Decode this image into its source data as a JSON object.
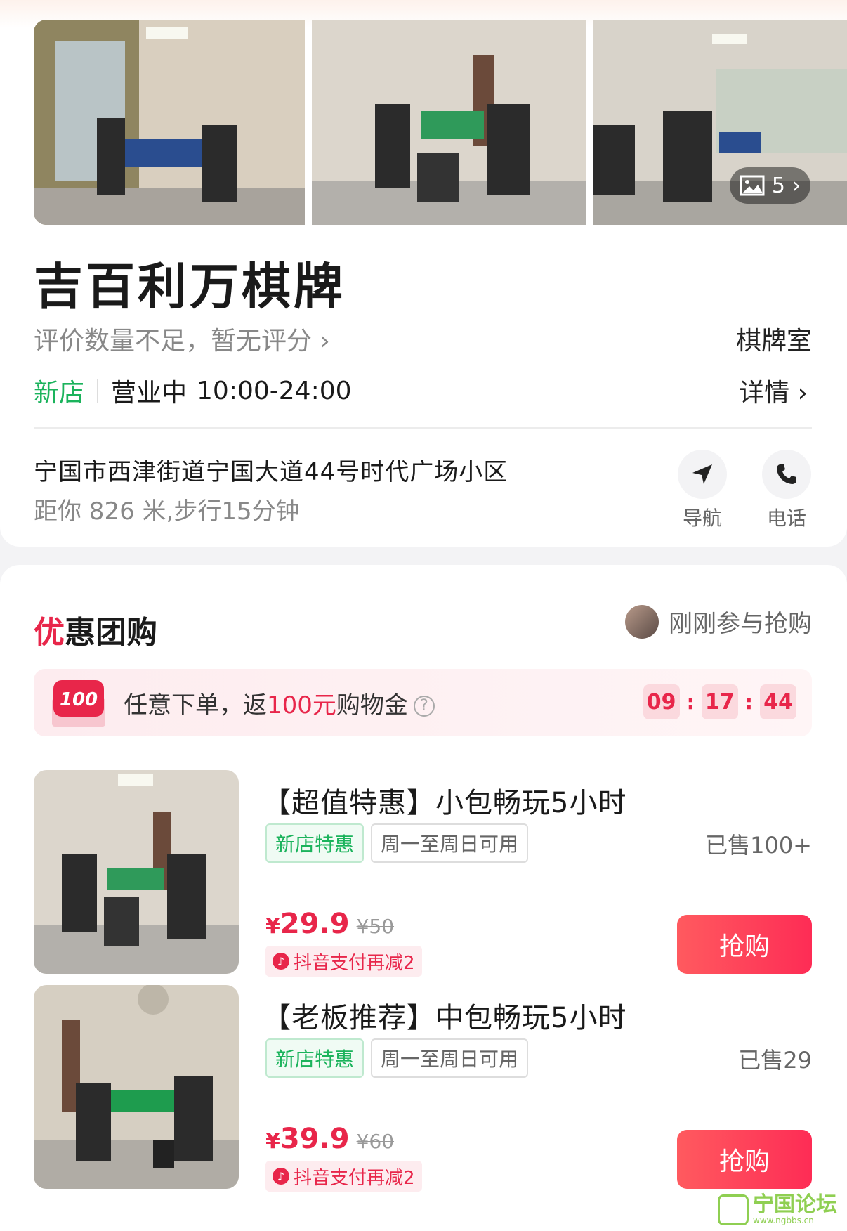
{
  "gallery": {
    "photo_count": "5"
  },
  "shop": {
    "name": "吉百利万棋牌",
    "rating_text": "评价数量不足，暂无评分",
    "category": "棋牌室",
    "new_label": "新店",
    "status": "营业中",
    "hours": "10:00-24:00",
    "detail_label": "详情",
    "address": "宁国市西津街道宁国大道44号时代广场小区",
    "distance": "距你 826 米,步行15分钟",
    "nav_label": "导航",
    "call_label": "电话"
  },
  "deals_section": {
    "title_first": "优",
    "title_rest": "惠团购",
    "recent_text": "刚刚参与抢购"
  },
  "promo": {
    "badge": "100",
    "text_before": "任意下单，返",
    "text_highlight": "100元",
    "text_after": "购物金",
    "help": "?",
    "countdown": {
      "h": "09",
      "m": "17",
      "s": "44",
      "sep": ":"
    }
  },
  "deals": [
    {
      "title": "【超值特惠】小包畅玩5小时",
      "tag1": "新店特惠",
      "tag2": "周一至周日可用",
      "sold": "已售100+",
      "yen": "¥",
      "price": "29.9",
      "orig": "¥50",
      "douyin": "抖音支付再减2",
      "buy": "抢购"
    },
    {
      "title": "【老板推荐】中包畅玩5小时",
      "tag1": "新店特惠",
      "tag2": "周一至周日可用",
      "sold": "已售29",
      "yen": "¥",
      "price": "39.9",
      "orig": "¥60",
      "douyin": "抖音支付再减2",
      "buy": "抢购"
    }
  ],
  "watermark": {
    "text": "宁国论坛",
    "url": "www.ngbbs.cn"
  },
  "colors": {
    "accent": "#e8264a",
    "green": "#1bb35c",
    "button": "#fe2c55"
  }
}
